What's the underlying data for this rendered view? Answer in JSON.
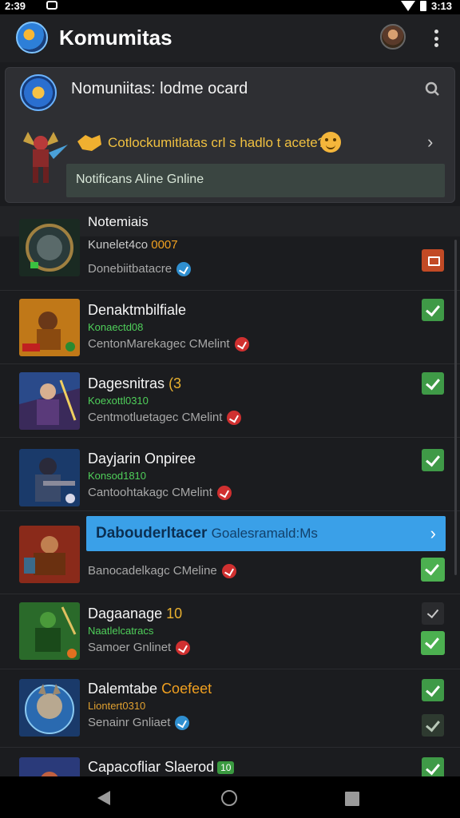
{
  "status_bar": {
    "time": "2:39",
    "battery_text": "3:13"
  },
  "app_bar": {
    "title": "Komumitas"
  },
  "card": {
    "title": "Nomuniitas: lodme ocard",
    "promo_text": "Cotlockumitlatas crl s hadlo t acete?",
    "notification_label": "Notificans Aline Gnline"
  },
  "section_header": "Notemiais",
  "rows": [
    {
      "title": "Kunelet4co",
      "title_tag": "0007",
      "subtitle": "",
      "desc": "Donebiitbatacre",
      "badge": "blue",
      "check": "orange"
    },
    {
      "title": "Denaktmbilfiale",
      "subtitle": "Konaectd08",
      "desc": "CentonMarekagec CMelint",
      "badge": "red",
      "check": "green"
    },
    {
      "title": "Dagesnitras",
      "title_tag": "(3",
      "subtitle": "Koexottl0310",
      "desc": "Centmotluetagec CMelint",
      "badge": "red",
      "check": "green"
    },
    {
      "title": "Dayjarin Onpiree",
      "subtitle": "Konsod1810",
      "desc": "Cantoohtakagc CMelint",
      "badge": "red",
      "check": "green"
    },
    {
      "title": "",
      "subtitle": "",
      "desc": "Banocadelkagc CMeline",
      "badge": "red",
      "check": "green-bright"
    },
    {
      "title": "Dagaanage",
      "title_tag": "10",
      "subtitle": "Naatlelcatracs",
      "desc": "Samoer Gnlinet",
      "badge": "red",
      "check": "green-bright",
      "check2": "grey"
    },
    {
      "title": "Dalemtabe",
      "title_tag": "Coefeet",
      "subtitle": "Liontert0310",
      "desc": "Senainr Gnliaet",
      "badge": "blue",
      "check": "green",
      "check2": "dark"
    },
    {
      "title": "Capacofliar Slaerod",
      "title_tag": "10",
      "subtitle": "",
      "desc": "",
      "badge": "",
      "check": "green"
    }
  ],
  "banner": {
    "title": "Dabouderltacer",
    "rest": "Goalesramald:Ms"
  },
  "colors": {
    "accent_blue": "#3aa0e8",
    "check_green": "#3f9a47",
    "subtitle_green": "#4fcf5a",
    "promo_yellow": "#f0c040"
  }
}
